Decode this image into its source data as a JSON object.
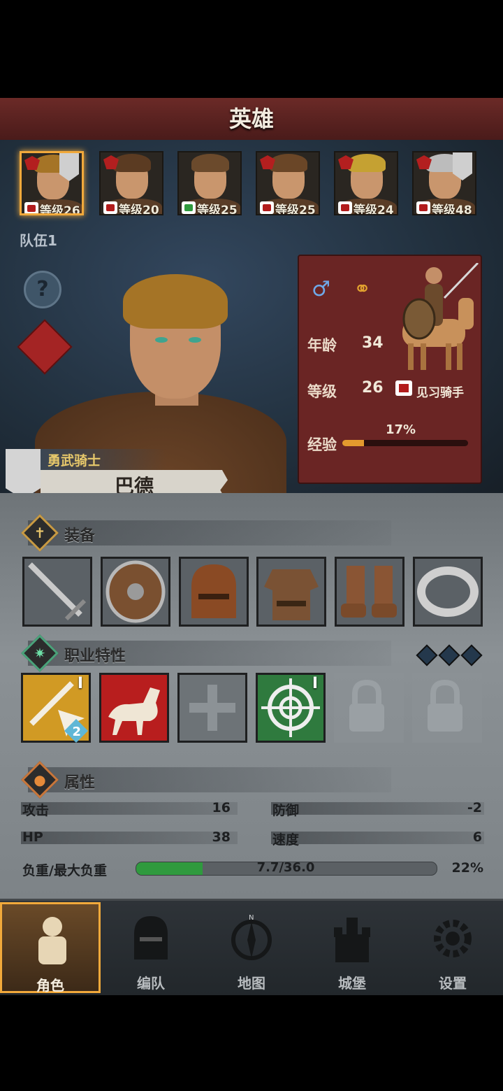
{
  "header": {
    "title": "英雄"
  },
  "roster": [
    {
      "level": "等级26",
      "hair": "#a57426",
      "badge": "red",
      "active": true
    },
    {
      "level": "等级20",
      "hair": "#5b3b22",
      "badge": "red",
      "active": false
    },
    {
      "level": "等级25",
      "hair": "#6b4a2c",
      "badge": "green",
      "active": false
    },
    {
      "level": "等级25",
      "hair": "#6a4627",
      "badge": "red",
      "active": false
    },
    {
      "level": "等级24",
      "hair": "#c5a132",
      "badge": "red",
      "active": false
    },
    {
      "level": "等级48",
      "hair": "#bcbcbc",
      "badge": "red",
      "active": false
    }
  ],
  "team": {
    "label": "队伍1"
  },
  "hero": {
    "class": "勇武骑士",
    "name": "巴德",
    "age_label": "年龄",
    "age": "34",
    "level_label": "等级",
    "level": "26",
    "rank": "见习骑手",
    "exp_label": "经验",
    "exp_percent_text": "17%",
    "exp_fraction": 0.17
  },
  "sections": {
    "equipment": "装备",
    "traits": "职业特性",
    "attributes": "属性"
  },
  "equipment": [
    {
      "icon": "sword-icon"
    },
    {
      "icon": "shield-icon"
    },
    {
      "icon": "helmet-icon"
    },
    {
      "icon": "armor-icon"
    },
    {
      "icon": "boots-icon"
    },
    {
      "icon": "ring-icon"
    }
  ],
  "traits": [
    {
      "icon": "sword-strike-icon",
      "tier": "I",
      "stack": "2"
    },
    {
      "icon": "horse-icon"
    },
    {
      "icon": "cross-icon"
    },
    {
      "icon": "target-icon",
      "tier": "I"
    },
    {
      "icon": "lock-icon"
    },
    {
      "icon": "lock-icon"
    }
  ],
  "stats": {
    "attack_label": "攻击",
    "attack": "16",
    "defense_label": "防御",
    "defense": "-2",
    "hp_label": "HP",
    "hp": "38",
    "speed_label": "速度",
    "speed": "6",
    "load_label": "负重/最大负重",
    "load_text": "7.7/36.0",
    "load_percent_text": "22%",
    "load_fraction": 0.22
  },
  "nav": [
    {
      "label": "角色",
      "icon": "knight-icon",
      "active": true
    },
    {
      "label": "编队",
      "icon": "helmet-icon",
      "active": false
    },
    {
      "label": "地图",
      "icon": "compass-icon",
      "active": false
    },
    {
      "label": "城堡",
      "icon": "castle-icon",
      "active": false
    },
    {
      "label": "设置",
      "icon": "gear-icon",
      "active": false
    }
  ],
  "colors": {
    "accent": "#f1a93b",
    "header": "#5a2220",
    "card": "#6a2524",
    "progress": "#2f9a3e"
  }
}
